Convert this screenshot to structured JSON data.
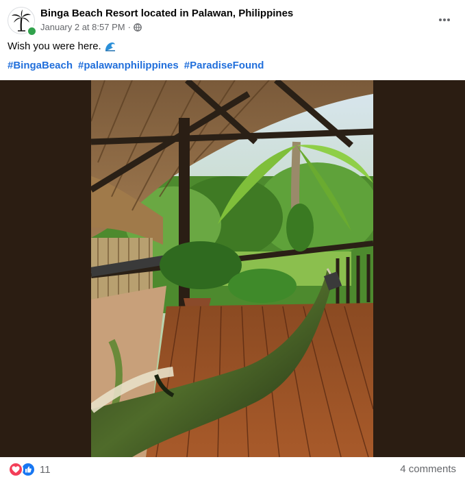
{
  "post": {
    "page_name": "Binga Beach Resort located in Palawan, Philippines",
    "date": "January 2 at 8:57 PM",
    "separator": "·",
    "privacy_icon": "globe-icon",
    "more_icon": "more-options-icon",
    "text": "Wish you were here.",
    "emoji": "wave-emoji",
    "hashtags": [
      "#BingaBeach",
      "#palawanphilippines",
      "#ParadiseFound"
    ]
  },
  "footer": {
    "reaction_icons": [
      "love-reaction-icon",
      "like-reaction-icon"
    ],
    "reaction_count": "11",
    "comments": "4 comments"
  },
  "colors": {
    "link": "#216fdb",
    "secondary_text": "#65676b",
    "online": "#31a24c",
    "love": "#f33e58",
    "like": "#1877f2",
    "media_background": "#2b1d12"
  }
}
